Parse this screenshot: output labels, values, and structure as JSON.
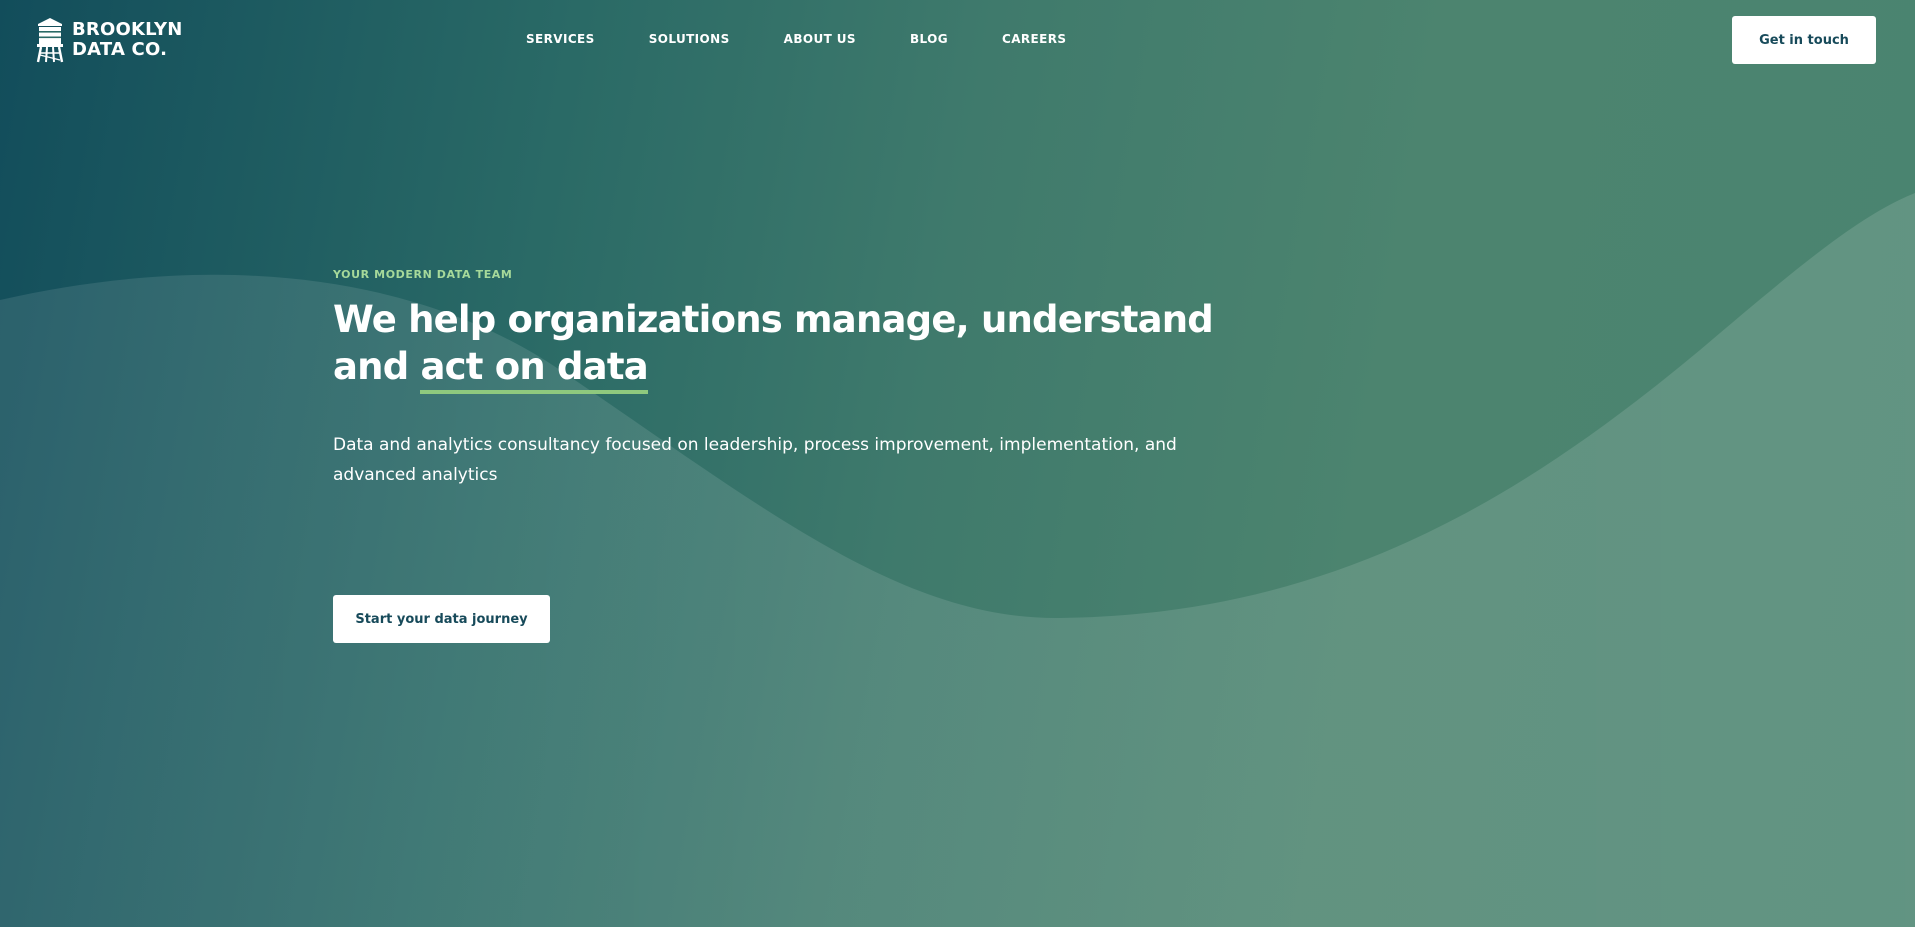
{
  "brand": {
    "line1": "BROOKLYN",
    "line2": "DATA CO.",
    "logo_icon": "water-tower-icon"
  },
  "nav": {
    "items": [
      {
        "label": "SERVICES"
      },
      {
        "label": "SOLUTIONS"
      },
      {
        "label": "ABOUT US"
      },
      {
        "label": "BLOG"
      },
      {
        "label": "CAREERS"
      }
    ]
  },
  "header": {
    "cta_label": "Get in touch"
  },
  "hero": {
    "eyebrow": "YOUR MODERN DATA TEAM",
    "headline_main": "We help organizations manage, understand and ",
    "headline_highlight": "act on data",
    "subtext": "Data and analytics consultancy focused on leadership, process improvement, implementation, and advanced analytics",
    "cta_label": "Start your data journey"
  },
  "colors": {
    "background_start": "#124d5b",
    "background_end": "#4a8470",
    "accent_green": "#8fc97e",
    "eyebrow_green": "#a6d99a",
    "button_text": "#174a5a",
    "button_bg": "#ffffff"
  }
}
